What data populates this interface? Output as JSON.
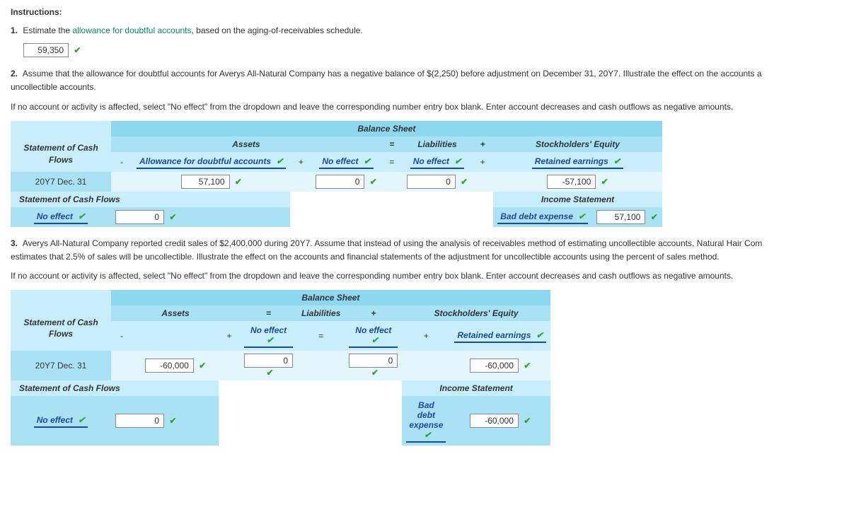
{
  "instructions_heading": "Instructions:",
  "q1": {
    "num": "1.",
    "pre": "Estimate the ",
    "link": "allowance for doubtful accounts",
    "post": ", based on the aging-of-receivables schedule.",
    "answer": "59,350"
  },
  "q2": {
    "num": "2.",
    "text": "Assume that the allowance for doubtful accounts for Averys All-Natural Company has a negative balance of $(2,250) before adjustment on December 31, 20Y7. Illustrate the effect on the accounts a",
    "text2": "uncollectible accounts.",
    "note": "If no account or activity is affected, select \"No effect\" from the dropdown and leave the corresponding number entry box blank. Enter account decreases and cash outflows as negative amounts."
  },
  "sheet1": {
    "title": "Balance Sheet",
    "cf_label": "Statement of Cash Flows",
    "col_assets": "Assets",
    "col_liab": "Liabilities",
    "col_se": "Stockholders' Equity",
    "dd_allowance": "Allowance for doubtful accounts",
    "dd_noeffect": "No effect",
    "dd_retained": "Retained earnings",
    "date": "20Y7 Dec. 31",
    "v_allowance": "57,100",
    "v_noeffect1": "0",
    "v_noeffect2": "0",
    "v_retained": "-57,100",
    "scf_title": "Statement of Cash Flows",
    "is_title": "Income Statement",
    "scf_dd": "No effect",
    "scf_val": "0",
    "is_dd": "Bad debt expense",
    "is_val": "57,100"
  },
  "q3": {
    "num": "3.",
    "text": "Averys All-Natural Company reported credit sales of $2,400,000 during 20Y7. Assume that instead of using the analysis of receivables method of estimating uncollectible accounts, Natural Hair Com",
    "text2": "estimates that 2.5% of sales will be uncollectible. Illustrate the effect on the accounts and financial statements of the adjustment for uncollectible accounts using the percent of sales method.",
    "note": "If no account or activity is affected, select \"No effect\" from the dropdown and leave the corresponding number entry box blank. Enter account decreases and cash outflows as negative amounts."
  },
  "sheet2": {
    "title": "Balance Sheet",
    "cf_label": "Statement of Cash Flows",
    "col_assets": "Assets",
    "col_liab": "Liabilities",
    "col_se": "Stockholders' Equity",
    "dd_allowance": "",
    "dd_noeffect": "No effect",
    "dd_retained": "Retained earnings",
    "date": "20Y7 Dec. 31",
    "v_allowance": "-60,000",
    "v_noeffect1": "0",
    "v_noeffect2": "0",
    "v_retained": "-60,000",
    "scf_title": "Statement of Cash Flows",
    "is_title": "Income Statement",
    "scf_dd": "No effect",
    "scf_val": "0",
    "is_dd": "Bad debt expense",
    "is_val": "-60,000"
  }
}
